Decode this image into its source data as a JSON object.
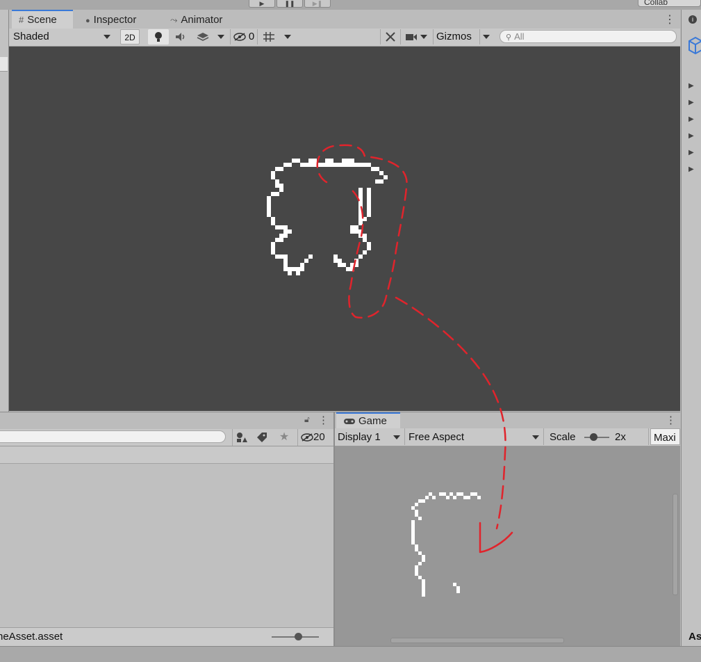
{
  "top_bar": {
    "play_glyph": "▶",
    "pause_glyph": "❚❚",
    "step_glyph": "▶❚",
    "collab_label": "Collab"
  },
  "scene_panel": {
    "tabs": [
      {
        "label": "Scene",
        "icon": "grid-icon",
        "glyph": "#",
        "active": true
      },
      {
        "label": "Inspector",
        "icon": "info-icon",
        "glyph": "●",
        "active": false
      },
      {
        "label": "Animator",
        "icon": "animator-icon",
        "glyph": "⤳",
        "active": false
      }
    ],
    "toolbar": {
      "draw_mode": "Shaded",
      "mode_2d": "2D",
      "hidden_count": "0",
      "gizmos_label": "Gizmos",
      "search_placeholder": "All"
    }
  },
  "project_panel": {
    "item_count": "20",
    "selected_file": "neAsset.asset"
  },
  "game_panel": {
    "tab_label": "Game",
    "display": "Display 1",
    "aspect": "Free Aspect",
    "scale_label": "Scale",
    "scale_value": "2x",
    "maximize_label": "Maxi"
  },
  "right_panel": {
    "bottom_label": "As"
  },
  "colors": {
    "scene_bg": "#474747",
    "game_bg": "#979797",
    "sprite": "#ffffff",
    "annotation": "#e0242c",
    "active_tab_accent": "#3a79d8"
  }
}
